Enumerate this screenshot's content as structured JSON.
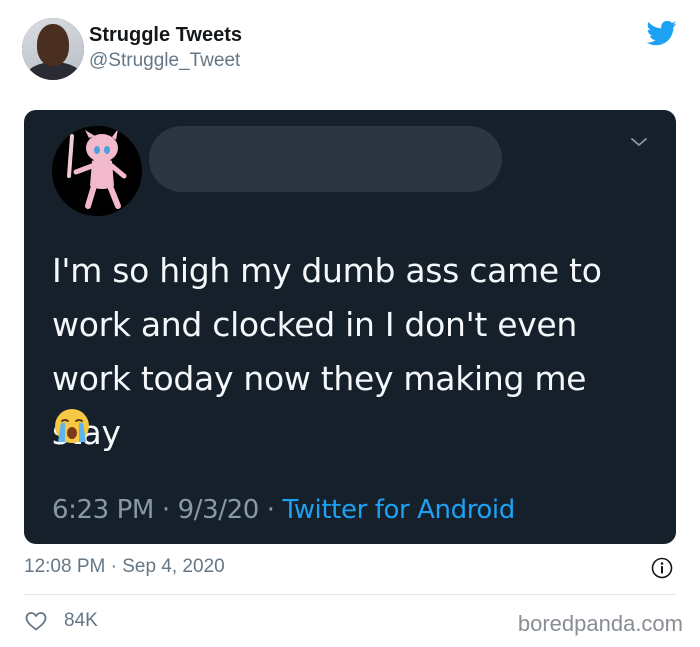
{
  "author": {
    "display_name": "Struggle Tweets",
    "handle": "@Struggle_Tweet",
    "avatar_icon": "person-avatar",
    "platform_icon": "twitter-bird-icon"
  },
  "embedded_tweet": {
    "text_lines": [
      "I'm so high my dumb ass came to",
      "work and clocked in I don't even",
      "work today now they making me stay"
    ],
    "emoji": "loudly-crying-face",
    "time": "6:23 PM",
    "date": "9/3/20",
    "separator": "·",
    "source": "Twitter for Android"
  },
  "footer": {
    "timestamp_time": "12:08 PM",
    "timestamp_sep": "·",
    "timestamp_date": "Sep 4, 2020",
    "likes": "84K",
    "watermark": "boredpanda.com"
  },
  "colors": {
    "card_bg": "#15202b",
    "accent": "#1da1f2",
    "muted": "#657786"
  }
}
